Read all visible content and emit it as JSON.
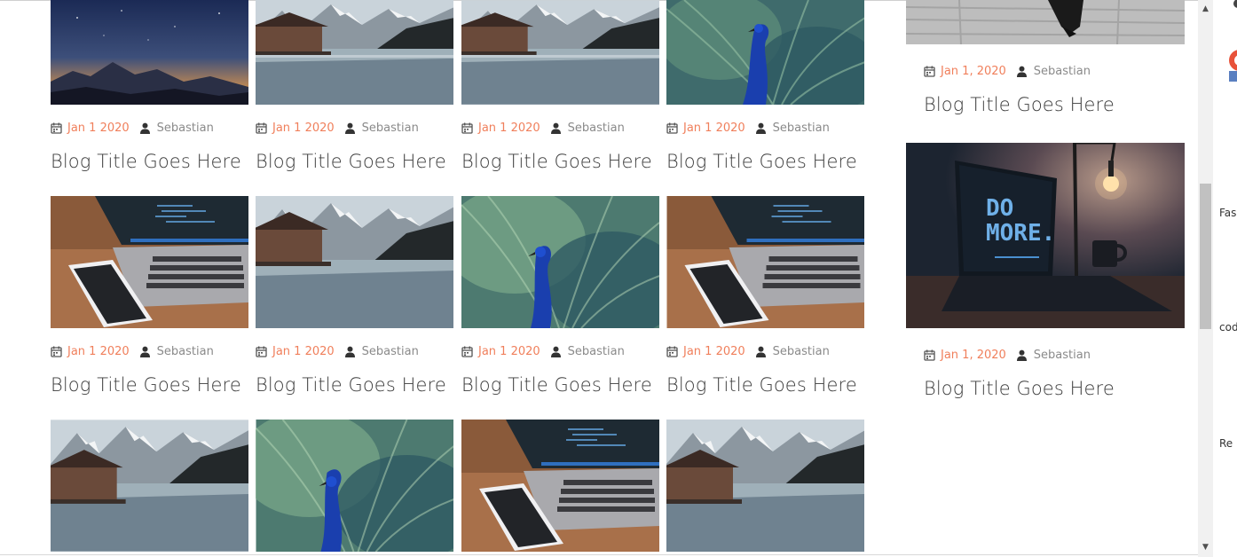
{
  "grid_posts": [
    {
      "image": "starry-mountain-sky",
      "date": "Jan 1 2020",
      "author": "Sebastian",
      "title": "Blog Title Goes Here"
    },
    {
      "image": "lake-boathouse-mountains",
      "date": "Jan 1 2020",
      "author": "Sebastian",
      "title": "Blog Title Goes Here"
    },
    {
      "image": "lake-boathouse-mountains",
      "date": "Jan 1 2020",
      "author": "Sebastian",
      "title": "Blog Title Goes Here"
    },
    {
      "image": "peacock",
      "date": "Jan 1 2020",
      "author": "Sebastian",
      "title": "Blog Title Goes Here"
    },
    {
      "image": "laptop-phone-desk",
      "date": "Jan 1 2020",
      "author": "Sebastian",
      "title": "Blog Title Goes Here"
    },
    {
      "image": "lake-boathouse-mountains",
      "date": "Jan 1 2020",
      "author": "Sebastian",
      "title": "Blog Title Goes Here"
    },
    {
      "image": "peacock",
      "date": "Jan 1 2020",
      "author": "Sebastian",
      "title": "Blog Title Goes Here"
    },
    {
      "image": "laptop-phone-desk",
      "date": "Jan 1 2020",
      "author": "Sebastian",
      "title": "Blog Title Goes Here"
    },
    {
      "image": "lake-boathouse-mountains"
    },
    {
      "image": "peacock"
    },
    {
      "image": "laptop-phone-desk"
    },
    {
      "image": "lake-boathouse-mountains"
    }
  ],
  "sidebar_posts": [
    {
      "image": "dark-wood-photo",
      "date": "Jan 1, 2020",
      "author": "Sebastian",
      "title": "Blog Title Goes Here"
    },
    {
      "image": "do-more-laptop",
      "date": "Jan 1, 2020",
      "author": "Sebastian",
      "title": "Blog Title Goes Here"
    }
  ],
  "laptop_screen_text": {
    "line1": "DO",
    "line2": "MORE."
  },
  "right_strip_labels": [
    "Fas",
    "cod",
    "Re"
  ],
  "colors": {
    "accent_date": "#f07f5b",
    "author": "#8a8a8a",
    "title": "#3b3b3b",
    "icon": "#333333"
  }
}
